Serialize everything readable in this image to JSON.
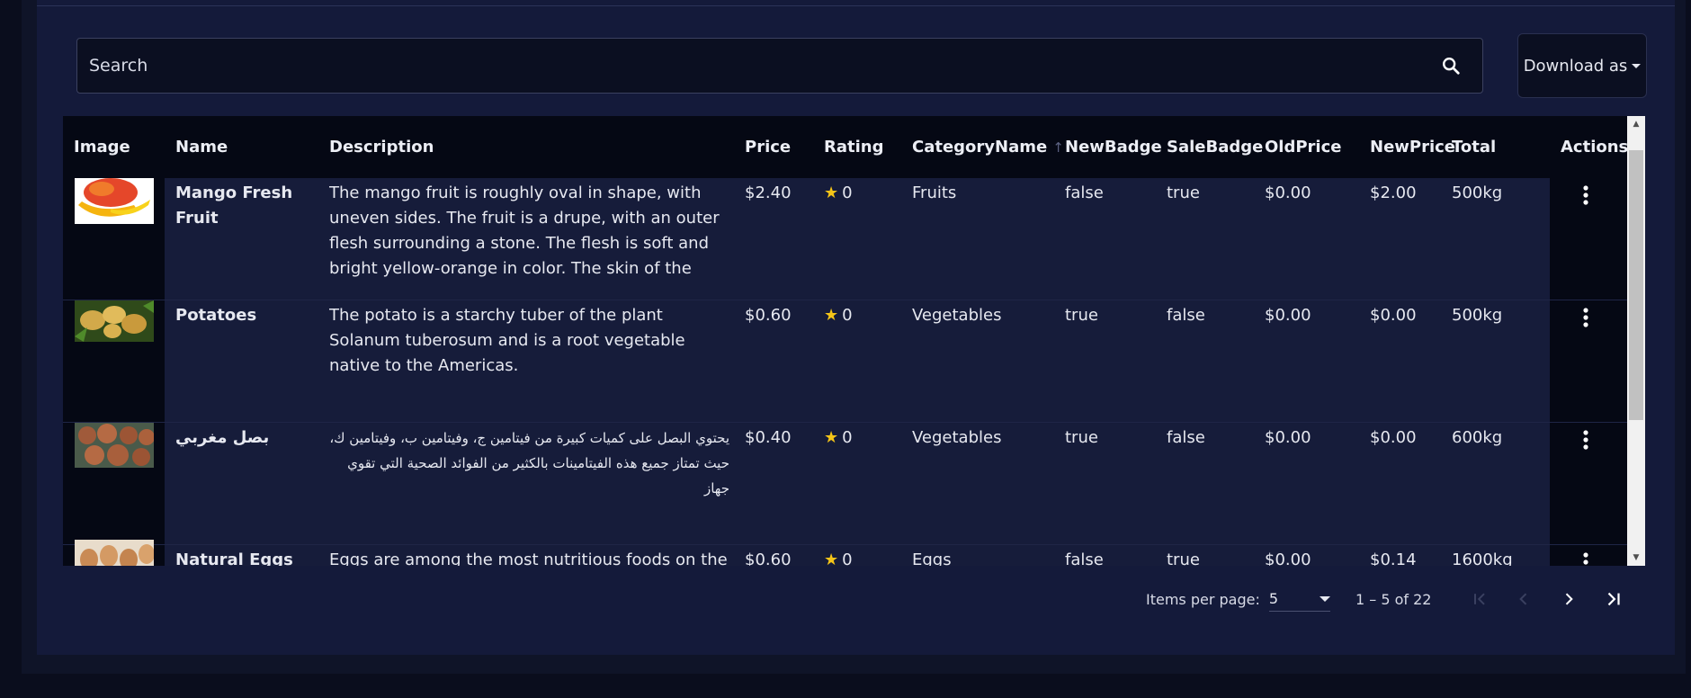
{
  "search": {
    "placeholder": "Search"
  },
  "toolbar": {
    "download_label": "Download as"
  },
  "table": {
    "columns": [
      "Image",
      "Name",
      "Description",
      "Price",
      "Rating",
      "CategoryName",
      "NewBadge",
      "SaleBadge",
      "OldPrice",
      "NewPrice",
      "Total",
      "Actions"
    ],
    "sort_column": "CategoryName",
    "rows": [
      {
        "name": "Mango Fresh Fruit",
        "description": "The mango fruit is roughly oval in shape, with uneven sides. The fruit is a drupe, with an outer flesh surrounding a stone. The flesh is soft and bright yellow-orange in color. The skin of the fruit is yellow-",
        "price": "$2.40",
        "rating": "0",
        "category": "Fruits",
        "new_badge": "false",
        "sale_badge": "true",
        "old_price": "$0.00",
        "new_price": "$2.00",
        "total": "500kg"
      },
      {
        "name": "Potatoes",
        "description": "The potato is a starchy tuber of the plant Solanum tuberosum and is a root vegetable native to the Americas.",
        "price": "$0.60",
        "rating": "0",
        "category": "Vegetables",
        "new_badge": "true",
        "sale_badge": "false",
        "old_price": "$0.00",
        "new_price": "$0.00",
        "total": "500kg"
      },
      {
        "name": "بصل مغربي",
        "description": "يحتوي البصل على كميات كبيرة من فيتامين ج، وفيتامين ب، وفيتامين ك، حيث تمتاز جميع هذه الفيتامينات بالكثير من الفوائد الصحية التي تقوي جهاز",
        "price": "$0.40",
        "rating": "0",
        "category": "Vegetables",
        "new_badge": "true",
        "sale_badge": "false",
        "old_price": "$0.00",
        "new_price": "$0.00",
        "total": "600kg"
      },
      {
        "name": "Natural Eggs",
        "description": "Eggs are among the most nutritious foods on the",
        "price": "$0.60",
        "rating": "0",
        "category": "Eggs",
        "new_badge": "false",
        "sale_badge": "true",
        "old_price": "$0.00",
        "new_price": "$0.14",
        "total": "1600kg"
      }
    ]
  },
  "pagination": {
    "items_per_page_label": "Items per page:",
    "items_per_page_value": "5",
    "range_label": "1 – 5 of 22"
  },
  "colors": {
    "accent_star": "#f5c518",
    "panel": "#141a3a",
    "header": "#050814"
  }
}
